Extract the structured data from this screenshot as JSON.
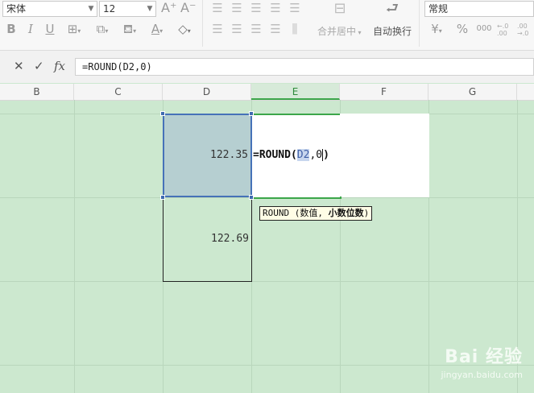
{
  "ribbon": {
    "font_name": "宋体",
    "font_size": "12",
    "merge_label": "合并居中",
    "wrap_label": "自动换行",
    "number_format": "常规",
    "currency_symbol": "¥",
    "percent_symbol": "%",
    "thousands_symbol": "000",
    "inc_decimal_top": "←.0",
    "inc_decimal_bottom": ".00",
    "dec_decimal_top": ".00",
    "dec_decimal_bottom": "→.0",
    "bold": "B",
    "italic": "I",
    "underline": "U",
    "font_color": "A",
    "grow_font": "A⁺",
    "shrink_font": "A⁻"
  },
  "formula_bar": {
    "cancel": "✕",
    "accept": "✓",
    "fx": "fx",
    "value": "=ROUND(D2,0)"
  },
  "columns": [
    "B",
    "C",
    "D",
    "E",
    "F",
    "G"
  ],
  "cells": {
    "d2": "122.35",
    "d3": "122.69"
  },
  "edit": {
    "prefix": "=ROUND(",
    "ref": "D2",
    "suffix": ",0"
  },
  "tooltip": {
    "func": "ROUND",
    "open": "(",
    "arg1": "数值,",
    "arg2": "小数位数",
    "close": ")"
  },
  "watermark": {
    "logo": "Bai 经验",
    "url": "jingyan.baidu.com"
  }
}
